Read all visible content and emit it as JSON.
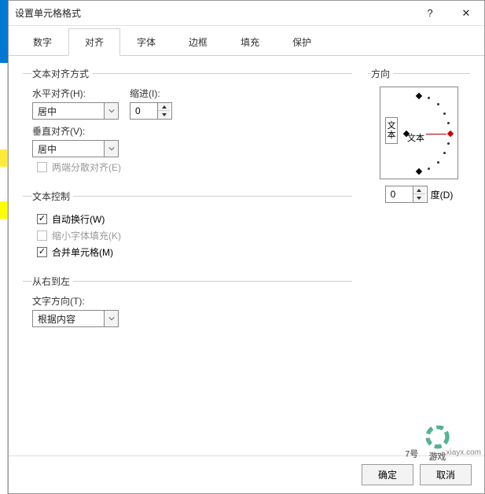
{
  "titlebar": {
    "title": "设置单元格格式",
    "help": "?",
    "close": "✕"
  },
  "tabs": {
    "items": [
      {
        "label": "数字"
      },
      {
        "label": "对齐"
      },
      {
        "label": "字体"
      },
      {
        "label": "边框"
      },
      {
        "label": "填充"
      },
      {
        "label": "保护"
      }
    ],
    "active_index": 1
  },
  "alignment": {
    "legend": "文本对齐方式",
    "horizontal": {
      "label": "水平对齐(H):",
      "value": "居中"
    },
    "vertical": {
      "label": "垂直对齐(V):",
      "value": "居中"
    },
    "indent": {
      "label": "缩进(I):",
      "value": "0"
    },
    "justify_distributed": {
      "label": "两端分散对齐(E)",
      "checked": false,
      "disabled": true
    }
  },
  "text_control": {
    "legend": "文本控制",
    "wrap_text": {
      "label": "自动换行(W)",
      "checked": true
    },
    "shrink_to_fit": {
      "label": "缩小字体填充(K)",
      "checked": false,
      "disabled": true
    },
    "merge_cells": {
      "label": "合并单元格(M)",
      "checked": true
    }
  },
  "rtl": {
    "legend": "从右到左",
    "text_direction": {
      "label": "文字方向(T):",
      "value": "根据内容"
    }
  },
  "orientation": {
    "legend": "方向",
    "v_label": "文本",
    "h_label": "文本",
    "degrees_value": "0",
    "degrees_suffix": "度(D)"
  },
  "footer": {
    "ok": "确定",
    "cancel": "取消"
  },
  "watermark": "xiayx.com"
}
